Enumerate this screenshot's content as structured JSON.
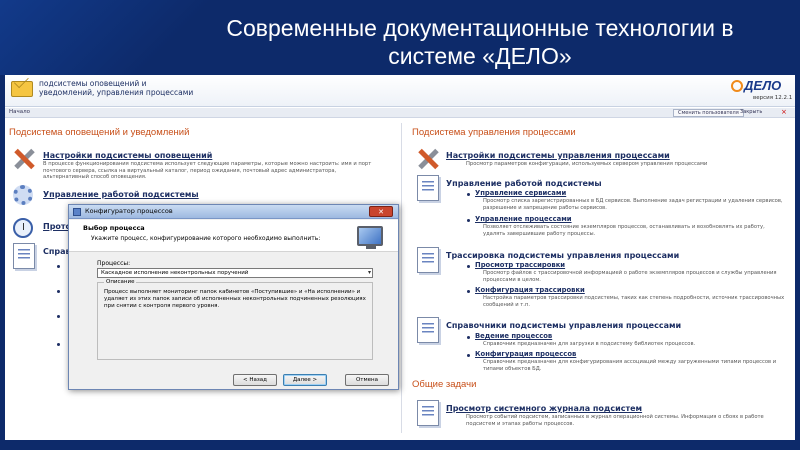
{
  "slide": {
    "title": "Современные документационные технологии в системе «ДЕЛО»"
  },
  "app": {
    "header_line1": "подсистемы оповещений и",
    "header_line2": "уведомлений, управления процессами",
    "logo_text": "ДЕЛО",
    "version": "версия 12.2.1",
    "nav": {
      "home": "Начало",
      "change_user": "Сменить пользователя",
      "close": "Закрыть",
      "x": "×"
    },
    "left": {
      "section_title": "Подсистема оповещений и уведомлений",
      "items": [
        {
          "title": "Настройки подсистемы оповещений",
          "desc": "В процессе функционирования подсистема использует следующие параметры, которые можно настроить: имя и порт почтового сервера, ссылка на виртуальный каталог, период ожидания, почтовый адрес администратора, альтернативный способ оповещения."
        },
        {
          "title": "Управление работой подсистемы"
        },
        {
          "title": "Прото"
        },
        {
          "title": "Справ"
        }
      ]
    },
    "right": {
      "section_title": "Подсистема управления процессами",
      "items": [
        {
          "title": "Настройки подсистемы управления процессами",
          "desc": "Просмотр параметров конфигурации, используемых сервером управления процессами"
        },
        {
          "title": "Управление работой подсистемы",
          "subs": [
            {
              "title": "Управление сервисами",
              "desc": "Просмотр списка зарегистрированных в БД сервисов. Выполнение задач регистрации и удаления сервисов, разрешение и запрещение работы сервисов."
            },
            {
              "title": "Управление процессами",
              "desc": "Позволяет отслеживать состояние экземпляров процессов, останавливать и возобновлять их работу, удалять завершившие работу процессы."
            }
          ]
        },
        {
          "title": "Трассировка подсистемы управления процессами",
          "subs": [
            {
              "title": "Просмотр трассировки",
              "desc": "Просмотр файлов с трассировочной информацией о работе экземпляров процессов и службы управления процессами в целом."
            },
            {
              "title": "Конфигурация трассировки",
              "desc": "Настройка параметров трассировки подсистемы, таких как степень подробности, источник трассировочных сообщений и т.п."
            }
          ]
        },
        {
          "title": "Справочники подсистемы управления процессами",
          "subs": [
            {
              "title": "Ведение процессов",
              "desc": "Справочник предназначен для загрузки в подсистему библиотек процессов."
            },
            {
              "title": "Конфигурация процессов",
              "desc": "Справочник предназначен для конфигурирования ассоциаций между загруженными типами процессов и типами объектов БД."
            }
          ]
        }
      ],
      "general_title": "Общие задачи",
      "general_item": {
        "title": "Просмотр системного журнала подсистем",
        "desc": "Просмотр событий подсистем, записанных в журнал операционной системы. Информация о сбоях в работе подсистем и этапах работы процессов."
      }
    }
  },
  "dialog": {
    "title": "Конфигуратор процессов",
    "close": "✕",
    "heading": "Выбор процесса",
    "subheading": "Укажите процесс, конфигурирование которого необходимо выполнить:",
    "process_label": "Процессы:",
    "selected_process": "Каскадное исполнение неконтрольных поручений",
    "select_arrow": "▾",
    "description_label": "Описание",
    "description_text": "Процесс выполняет мониторинг папок кабинетов «Поступившие» и «На исполнении» и удаляет из этих папок записи об исполненных неконтрольных подчиненных резолюциях при снятии с контроля первого уровня.",
    "buttons": {
      "back": "< Назад",
      "next": "Далее >",
      "cancel": "Отмена"
    }
  }
}
